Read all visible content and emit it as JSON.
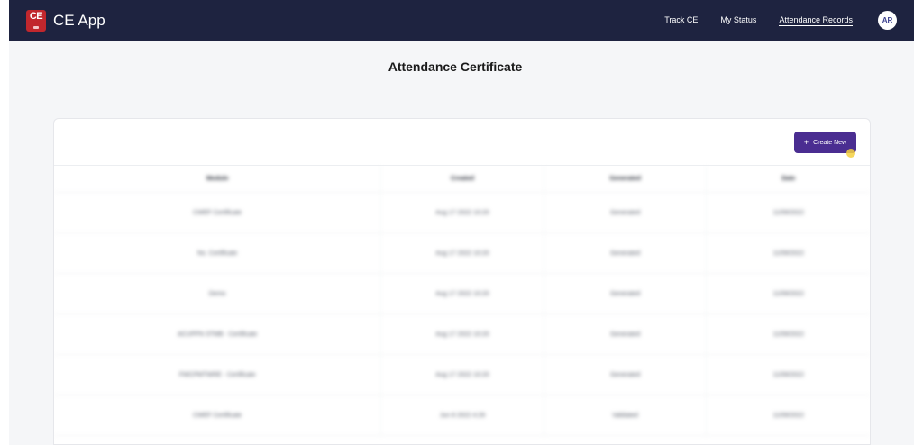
{
  "app": {
    "brand_logo_text": "CE",
    "brand_name": "CE App"
  },
  "nav": {
    "links": [
      {
        "label": "Track CE"
      },
      {
        "label": "My Status"
      },
      {
        "label": "Attendance Records"
      }
    ],
    "avatar_initials": "AR"
  },
  "page": {
    "title": "Attendance Certificate"
  },
  "toolbar": {
    "create_icon": "plus-icon",
    "create_label": "Create New"
  },
  "table": {
    "headers": [
      "Module",
      "Created",
      "Generated",
      "Date"
    ],
    "rows": [
      [
        "CWEF Certificate",
        "Aug 17 2022 10:20",
        "Generated",
        "11/09/2022"
      ],
      [
        "No. Certificate",
        "Aug 17 2022 10:20",
        "Generated",
        "11/09/2022"
      ],
      [
        "Demo",
        "Aug 17 2022 10:20",
        "Generated",
        "11/09/2022"
      ],
      [
        "ACUPPN STMB - Certificate",
        "Aug 17 2022 10:20",
        "Generated",
        "11/09/2022"
      ],
      [
        "FWCPMTWRE - Certificate",
        "Aug 17 2022 10:20",
        "Generated",
        "11/09/2022"
      ],
      [
        "CWEF Certificate",
        "Jun 8 2022 4:29",
        "Validated",
        "11/09/2022"
      ]
    ]
  },
  "colors": {
    "navbar": "#1e2340",
    "accent_button": "#4a2d91",
    "logo": "#c1272d"
  }
}
